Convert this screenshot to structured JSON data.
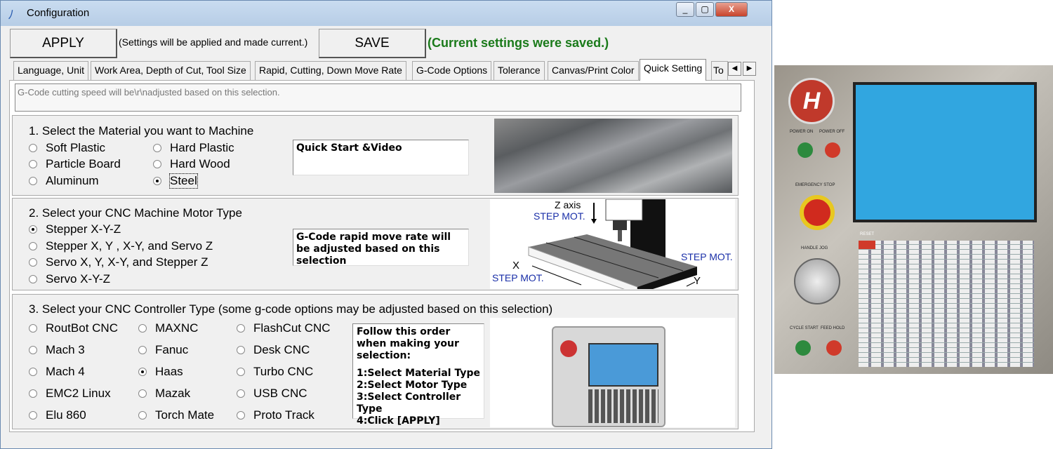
{
  "window": {
    "title": "Configuration",
    "min": "_",
    "max": "▢",
    "close": "X"
  },
  "toolbar": {
    "apply_label": "APPLY",
    "apply_note": "(Settings will be applied and made current.)",
    "save_label": "SAVE",
    "save_note": "(Current settings were saved.)",
    "save_note_color": "#1a7a1a"
  },
  "tabs": [
    "Language, Unit",
    "Work Area, Depth of Cut, Tool Size",
    "Rapid, Cutting, Down Move Rate",
    "G-Code Options",
    "Tolerance",
    "Canvas/Print Color",
    "Quick Setting",
    "To"
  ],
  "info_text": "G-Code cutting speed will be\\r\\nadjusted based on this selection.",
  "material": {
    "heading": "1. Select the Material you want  to Machine",
    "options": [
      "Soft Plastic",
      "Hard Plastic",
      "Particle Board",
      "Hard Wood",
      "Aluminum",
      "Steel"
    ],
    "selected": "Steel",
    "note": "Quick Start &Video"
  },
  "motor": {
    "heading": "2. Select your CNC Machine Motor Type",
    "options": [
      "Stepper X-Y-Z",
      "Stepper X, Y , X-Y, and Servo Z",
      "Servo X, Y, X-Y, and Stepper Z",
      "Servo X-Y-Z"
    ],
    "selected": "Stepper X-Y-Z",
    "note": "G-Code rapid move rate will be adjusted based on this selection",
    "diagram": {
      "z_axis": "Z axis",
      "z_motor": "STEP MOT.",
      "y_motor": "STEP MOT.",
      "x_label": "X",
      "x_motor": "STEP MOT.",
      "y_label": "Y"
    }
  },
  "controller": {
    "heading": "3. Select your CNC Controller Type (some g-code options may be adjusted based on this selection)",
    "options": [
      "RoutBot CNC",
      "MAXNC",
      "FlashCut CNC",
      "Mach 3",
      "Fanuc",
      "Desk CNC",
      "Mach 4",
      "Haas",
      "Turbo CNC",
      "EMC2 Linux",
      "Mazak",
      "USB CNC",
      "Elu 860",
      "Torch Mate",
      "Proto Track"
    ],
    "selected": "Haas",
    "instructions": [
      "Follow this order when making your selection:",
      "",
      "1:Select Material Type",
      "2:Select Motor Type",
      "3:Select Controller Type",
      "4:Click [APPLY]"
    ]
  },
  "panel_photo": {
    "labels": [
      "POWER ON",
      "POWER OFF",
      "EMERGENCY STOP",
      "HANDLE JOG",
      "CYCLE START",
      "FEED HOLD",
      "RESET"
    ]
  }
}
